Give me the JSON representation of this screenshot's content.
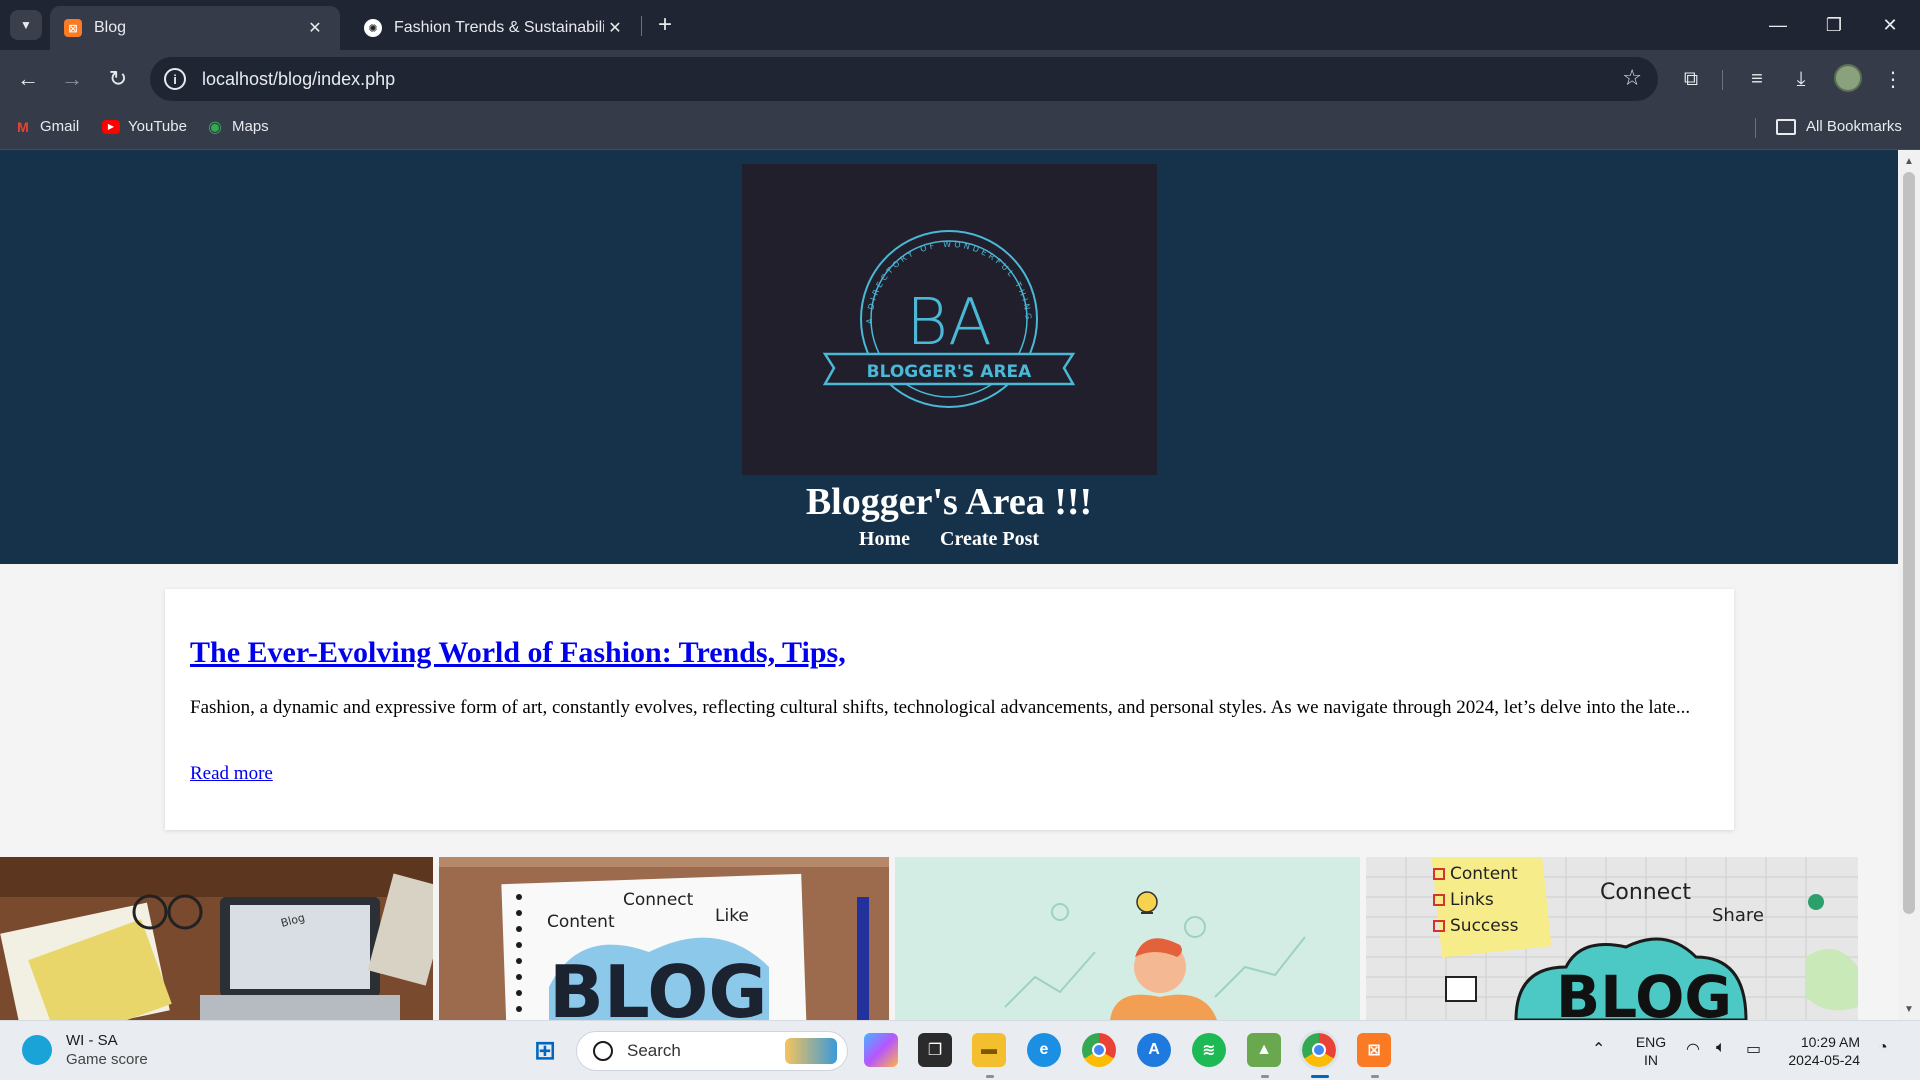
{
  "browser": {
    "tabs": [
      {
        "title": "Blog",
        "active": true,
        "favicon": "xampp-icon"
      },
      {
        "title": "Fashion Trends & Sustainability",
        "active": false,
        "favicon": "chatgpt-icon"
      }
    ],
    "url": "localhost/blog/index.php",
    "bookmarks": [
      {
        "label": "Gmail",
        "icon": "gmail-icon"
      },
      {
        "label": "YouTube",
        "icon": "youtube-icon"
      },
      {
        "label": "Maps",
        "icon": "maps-icon"
      }
    ],
    "all_bookmarks_label": "All Bookmarks"
  },
  "site": {
    "logo": {
      "monogram": "BA",
      "ring_text": "A DIRECTORY OF WONDERFUL THINGS",
      "banner_text": "BLOGGER'S AREA",
      "accent_color": "#4ab8d6"
    },
    "title": "Blogger's Area !!!",
    "nav": [
      {
        "label": "Home"
      },
      {
        "label": "Create Post"
      }
    ],
    "header_color": "#16324a"
  },
  "post": {
    "title": "The Ever-Evolving World of Fashion: Trends, Tips,",
    "excerpt": "Fashion, a dynamic and expressive form of art, constantly evolves, reflecting cultural shifts, technological advancements, and personal styles. As we navigate through 2024, let’s delve into the late...",
    "read_more": "Read more"
  },
  "thumbnails": [
    {
      "name": "workspace-laptop-image",
      "words": [
        "Blog"
      ]
    },
    {
      "name": "blog-notebook-image",
      "words": [
        "Content",
        "Connect",
        "Like",
        "BLOG"
      ]
    },
    {
      "name": "thinking-person-image",
      "words": []
    },
    {
      "name": "blog-sticky-notes-image",
      "words": [
        "Content",
        "Links",
        "Success",
        "Connect",
        "Share",
        "BLOG"
      ]
    }
  ],
  "taskbar": {
    "weather_title": "WI - SA",
    "weather_subtitle": "Game score",
    "search_placeholder": "Search",
    "language_top": "ENG",
    "language_bottom": "IN",
    "time": "10:29 AM",
    "date": "2024-05-24"
  }
}
